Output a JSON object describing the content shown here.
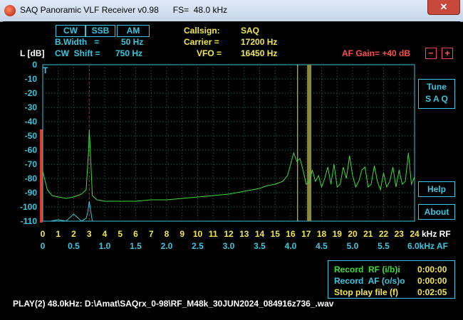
{
  "window": {
    "title": "SAQ Panoramic VLF Receiver v0.98      FS=  48.0 kHz",
    "close_label": "✕"
  },
  "modes": {
    "cw": "CW",
    "ssb": "SSB",
    "am": "AM"
  },
  "params": {
    "bwidth_label": "B.Width   =",
    "bwidth_value": "50 Hz",
    "shift_label": "CW  Shift =",
    "shift_value": "750 Hz",
    "level_label": "L [dB]"
  },
  "station": {
    "callsign_label": "Callsign:",
    "callsign_value": "SAQ",
    "carrier_label": "Carrier =",
    "carrier_value": "17200 Hz",
    "vfo_label": "VFO =",
    "vfo_value": "16450 Hz"
  },
  "af_gain": {
    "label": "AF Gain= +40 dB",
    "minus": "−",
    "plus": "+"
  },
  "buttons": {
    "tune_line1": "Tune",
    "tune_line2": "S A Q",
    "help": "Help",
    "about": "About"
  },
  "y_ticks": [
    "0",
    "-10",
    "-20",
    "-30",
    "-40",
    "-50",
    "-60",
    "-70",
    "-80",
    "-90",
    "-100",
    "-110"
  ],
  "x_rf_ticks": [
    "0",
    "1",
    "2",
    "3",
    "4",
    "5",
    "6",
    "7",
    "8",
    "9",
    "10",
    "11",
    "12",
    "13",
    "14",
    "15",
    "16",
    "17",
    "18",
    "19",
    "20",
    "21",
    "22",
    "23",
    "24"
  ],
  "x_rf_unit": "kHz RF",
  "x_af_ticks": [
    "0",
    "0.5",
    "1.0",
    "1.5",
    "2.0",
    "2.5",
    "3.0",
    "3.5",
    "4.0",
    "4.5",
    "5.0",
    "5.5"
  ],
  "x_af_last": "6.0kHz AF",
  "record": {
    "rf_label": "Record  RF (i/b)i",
    "rf_time": "0:00:00",
    "af_label": "Record  AF (o/s)o",
    "af_time": "0:00:00",
    "stop_label": "Stop play file (f)",
    "stop_time": "0:02:05"
  },
  "status_line": "PLAY(2) 48.0kHz: D:\\Amat\\SAQrx_0-98\\RF_M48k_30JUN2024_084916z736_.wav",
  "colors": {
    "spectrum": "#3ddc3d",
    "af_spectrum": "#39c6e0",
    "grid": "#1f6e5a",
    "vfo_line": "#f2e84a",
    "carrier_band": "#8a8a3a",
    "bfo_line": "#d02020"
  },
  "chart_data": {
    "type": "line",
    "xlabel": "kHz RF",
    "ylabel": "L [dB]",
    "xlim": [
      0,
      24
    ],
    "ylim": [
      -110,
      0
    ],
    "grid": true,
    "markers": {
      "vfo_khz": 16.45,
      "carrier_khz": 17.2,
      "bfo_khz": 3.0
    },
    "series": [
      {
        "x": [
          0,
          0.3,
          0.6,
          1,
          1.5,
          2,
          2.5,
          2.8,
          2.95,
          3.0,
          3.05,
          3.2,
          3.5,
          4,
          5,
          6,
          7,
          8,
          9,
          10,
          11,
          12,
          13,
          14,
          14.5,
          15,
          15.5,
          15.8,
          16.0,
          16.2,
          16.4,
          16.6,
          16.8,
          17.0,
          17.2,
          17.4,
          17.6,
          17.8,
          18.0,
          18.2,
          18.4,
          18.6,
          18.8,
          19.0,
          19.2,
          19.4,
          19.6,
          19.8,
          20.0,
          20.2,
          20.4,
          20.6,
          20.8,
          21.0,
          21.2,
          21.4,
          21.6,
          21.8,
          22.0,
          22.2,
          22.4,
          22.6,
          22.8,
          23.0,
          23.2,
          23.4,
          23.6,
          23.8,
          24.0
        ],
        "y": [
          -75,
          -88,
          -92,
          -93,
          -94,
          -93,
          -91,
          -88,
          -62,
          -46,
          -55,
          -92,
          -95,
          -96,
          -96,
          -96,
          -95,
          -95,
          -94,
          -93,
          -92,
          -91,
          -89,
          -87,
          -85,
          -84,
          -82,
          -78,
          -70,
          -62,
          -68,
          -66,
          -74,
          -84,
          -83,
          -74,
          -82,
          -78,
          -86,
          -80,
          -72,
          -84,
          -70,
          -86,
          -84,
          -72,
          -80,
          -64,
          -78,
          -86,
          -82,
          -74,
          -72,
          -86,
          -84,
          -71,
          -82,
          -88,
          -76,
          -86,
          -82,
          -72,
          -86,
          -74,
          -84,
          -82,
          -62,
          -84,
          -79
        ]
      },
      {
        "x": [
          0,
          0.5,
          1.0,
          1.5,
          2.0,
          2.5,
          2.8,
          2.9,
          3.0,
          3.1,
          3.2,
          3.4,
          3.6
        ],
        "y": [
          -110,
          -110,
          -109,
          -110,
          -105,
          -110,
          -108,
          -104,
          -96,
          -103,
          -110,
          -110,
          -110
        ]
      }
    ]
  }
}
